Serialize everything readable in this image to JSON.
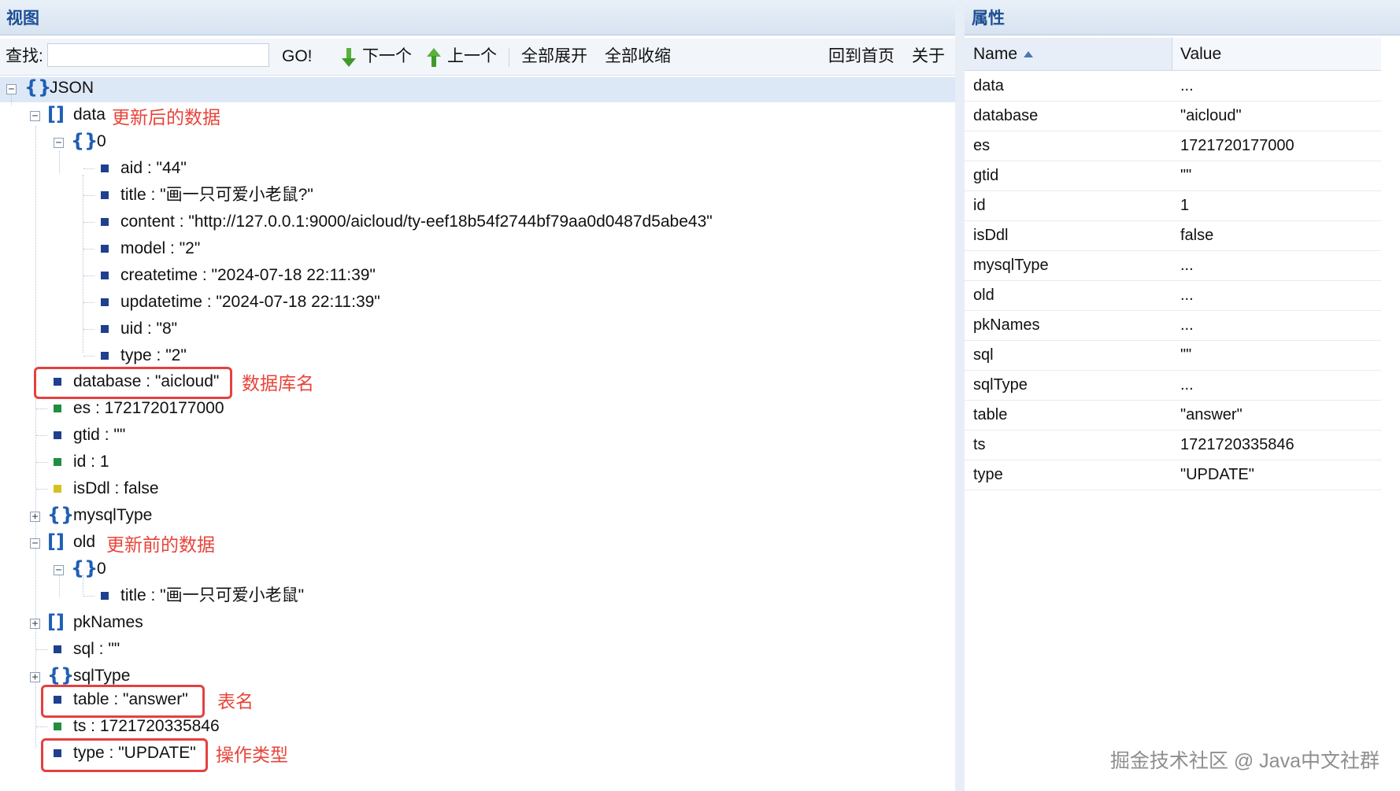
{
  "left_panel": {
    "title": "视图",
    "toolbar": {
      "search_label": "查找:",
      "search_value": "",
      "go": "GO!",
      "next": "下一个",
      "prev": "上一个",
      "expand_all": "全部展开",
      "collapse_all": "全部收缩",
      "home": "回到首页",
      "about": "关于"
    },
    "tree": {
      "root": "JSON",
      "data": "data",
      "data_note": "更新后的数据",
      "data_0": "0",
      "data_fields": [
        "aid : \"44\"",
        "title : \"画一只可爱小老鼠?\"",
        "content : \"http://127.0.0.1:9000/aicloud/ty-eef18b54f2744bf79aa0d0487d5abe43\"",
        "model : \"2\"",
        "createtime : \"2024-07-18 22:11:39\"",
        "updatetime : \"2024-07-18 22:11:39\"",
        "uid : \"8\"",
        "type : \"2\""
      ],
      "database": "database : \"aicloud\"",
      "database_note": "数据库名",
      "es": "es : 1721720177000",
      "gtid": "gtid : \"\"",
      "id": "id : 1",
      "isDdl": "isDdl : false",
      "mysqlType": "mysqlType",
      "old": "old",
      "old_note": "更新前的数据",
      "old_0": "0",
      "old_title": "title : \"画一只可爱小老鼠\"",
      "pkNames": "pkNames",
      "sql": "sql : \"\"",
      "sqlType": "sqlType",
      "table": "table : \"answer\"",
      "table_note": "表名",
      "ts": "ts : 1721720335846",
      "type": "type : \"UPDATE\"",
      "type_note": "操作类型"
    }
  },
  "right_panel": {
    "title": "属性",
    "columns": {
      "name": "Name",
      "value": "Value"
    },
    "rows": [
      {
        "name": "data",
        "value": "..."
      },
      {
        "name": "database",
        "value": "\"aicloud\""
      },
      {
        "name": "es",
        "value": "1721720177000"
      },
      {
        "name": "gtid",
        "value": "\"\""
      },
      {
        "name": "id",
        "value": "1"
      },
      {
        "name": "isDdl",
        "value": "false"
      },
      {
        "name": "mysqlType",
        "value": "..."
      },
      {
        "name": "old",
        "value": "..."
      },
      {
        "name": "pkNames",
        "value": "..."
      },
      {
        "name": "sql",
        "value": "\"\""
      },
      {
        "name": "sqlType",
        "value": "..."
      },
      {
        "name": "table",
        "value": "\"answer\""
      },
      {
        "name": "ts",
        "value": "1721720335846"
      },
      {
        "name": "type",
        "value": "\"UPDATE\""
      }
    ]
  },
  "watermark": "掘金技术社区 @ Java中文社群",
  "colors": {
    "header_text": "#1d4f94",
    "annotation_red": "#e8443a",
    "brace_blue": "#1f5fb3"
  }
}
